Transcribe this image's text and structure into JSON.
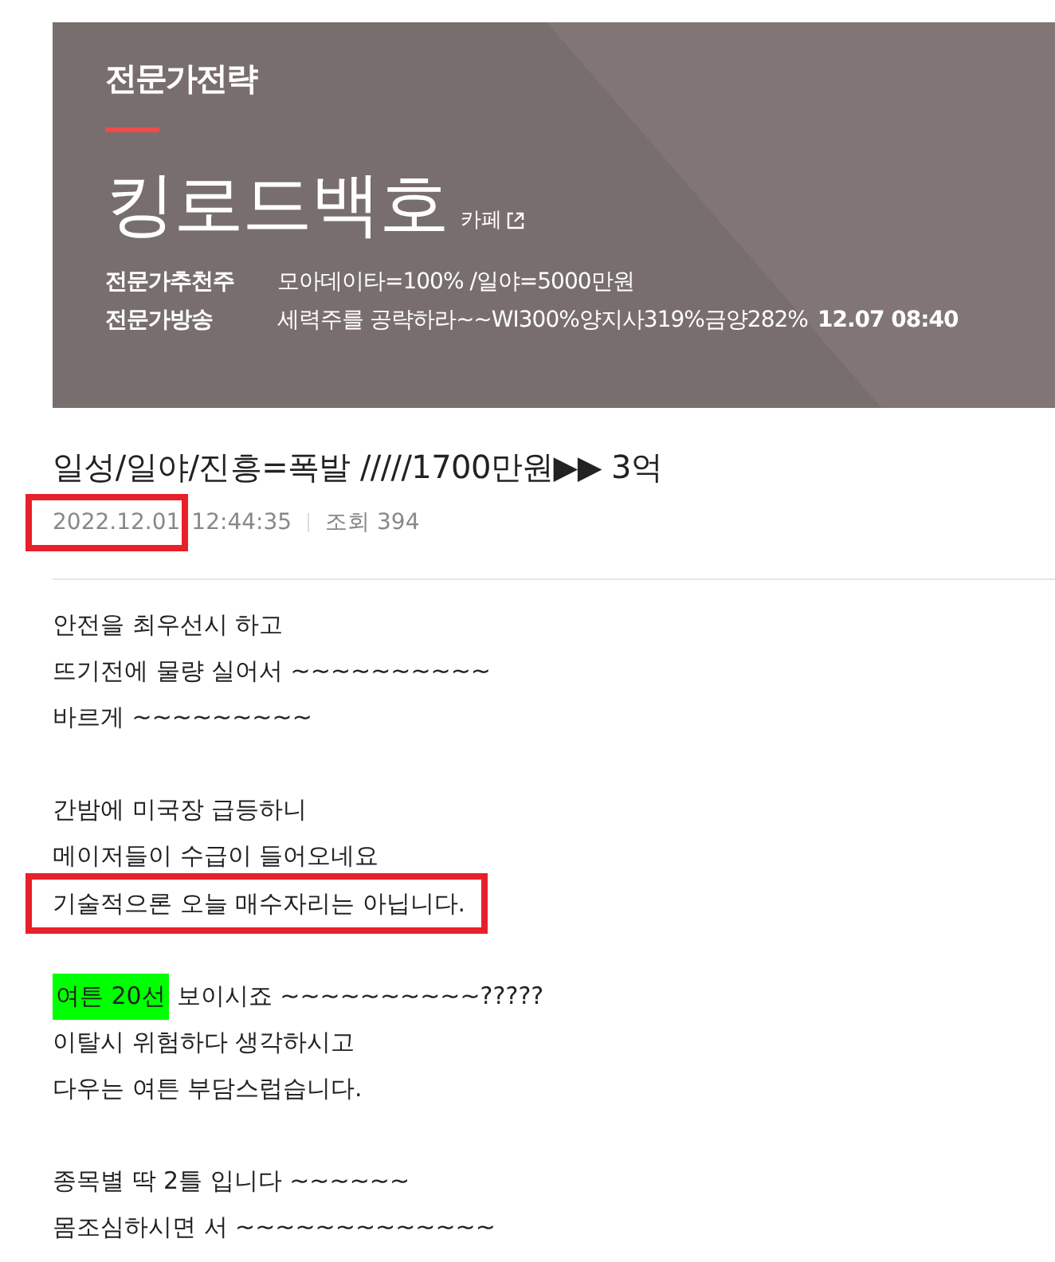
{
  "banner": {
    "section": "전문가전략",
    "expert_name": "킹로드백호",
    "cafe_link": "카페",
    "rows": [
      {
        "label": "전문가추천주",
        "value": "모아데이타=100% /일야=5000만원"
      },
      {
        "label": "전문가방송",
        "value": "세력주를 공략하라~~WI300%양지사319%금양282%",
        "time": "12.07 08:40"
      }
    ]
  },
  "post": {
    "title": "일성/일야/진흥=폭발 /////1700만원▶▶ 3억",
    "meta": {
      "date": "2022.12.01",
      "date_boxed": true,
      "time": "12:44:35",
      "views_label": "조회",
      "views": "394"
    },
    "paragraphs": [
      [
        {
          "text": "안전을 최우선시 하고",
          "boxed": false
        },
        {
          "text": "뜨기전에 물량 실어서 ~~~~~~~~~~",
          "boxed": false
        },
        {
          "text": "바르게 ~~~~~~~~~",
          "boxed": false
        }
      ],
      [
        {
          "text": "간밤에 미국장 급등하니",
          "boxed": false
        },
        {
          "text": "메이저들이 수급이 들어오네요",
          "boxed": false
        },
        {
          "text": "기술적으론 오늘 매수자리는 아닙니다.",
          "boxed": true
        }
      ],
      [
        {
          "highlight": "여튼 20선",
          "text": "보이시죠 ~~~~~~~~~~?????",
          "boxed": false
        },
        {
          "text": "이탈시 위험하다 생각하시고",
          "boxed": false
        },
        {
          "text": "다우는 여튼 부담스럽습니다.",
          "boxed": false
        }
      ],
      [
        {
          "text": "종목별 딱 2틀 입니다 ~~~~~~",
          "boxed": false
        },
        {
          "text": "몸조심하시면 서 ~~~~~~~~~~~~~",
          "boxed": false
        }
      ]
    ]
  }
}
